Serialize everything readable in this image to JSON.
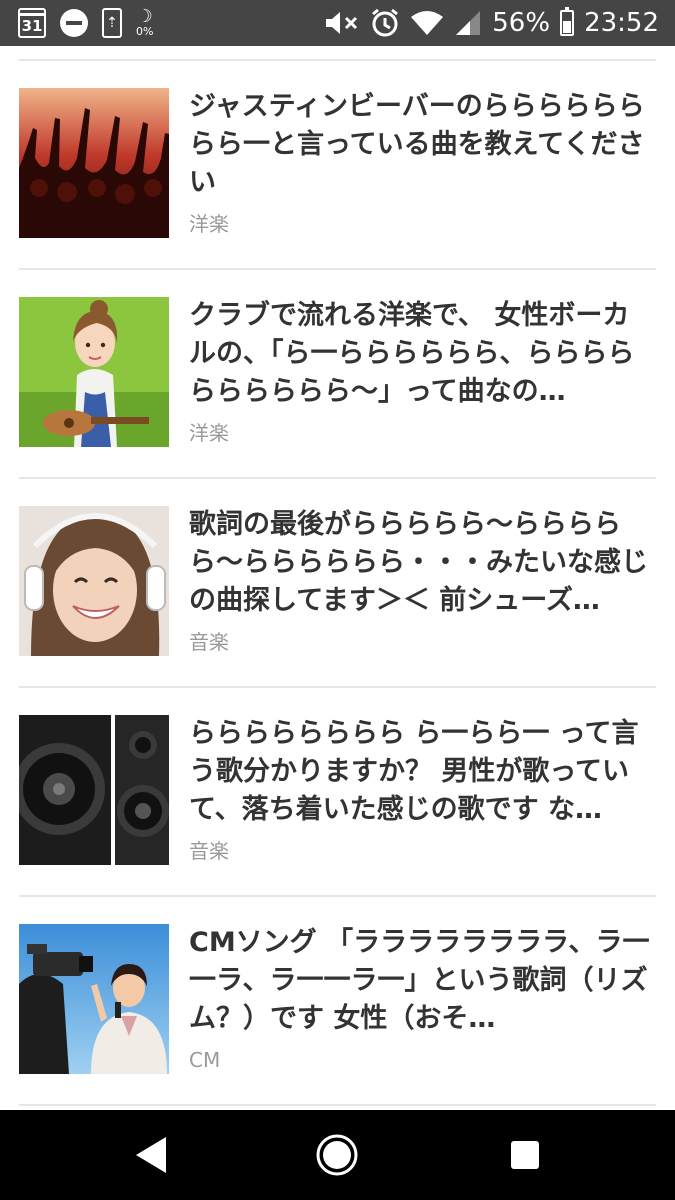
{
  "status_bar": {
    "calendar_day": "31",
    "battery_saver_percent": "0%",
    "battery_percent": "56%",
    "battery_level": 0.56,
    "time": "23:52",
    "icons": [
      "calendar-icon",
      "do-not-disturb-icon",
      "update-icon",
      "battery-saver-icon",
      "mute-icon",
      "alarm-icon",
      "wifi-icon",
      "cell-signal-icon",
      "battery-icon"
    ]
  },
  "items": [
    {
      "title": "ジャスティンビーバーのらららららららら一と言っている曲を教えてください",
      "category": "洋楽",
      "thumbnail": "concert-crowd"
    },
    {
      "title": "クラブで流れる洋楽で、 女性ボーカルの、「ら一らららららら、らららららららららら〜」って曲なの…",
      "category": "洋楽",
      "thumbnail": "woman-with-ukulele"
    },
    {
      "title": "歌詞の最後がららららら〜ららららら〜らららららら・・・みたいな感じの曲探してます＞＜ 前シューズ…",
      "category": "音楽",
      "thumbnail": "woman-with-headphones"
    },
    {
      "title": "らららららららら ら一らら一 って言う歌分かりますか？ 男性が歌っていて、落ち着いた感じの歌です な…",
      "category": "音楽",
      "thumbnail": "speakers"
    },
    {
      "title": "CMソング 「ララララララララ、ラ一一ラ、ラ一一ラ一」という歌詞（リズム？）です 女性（おそ…",
      "category": "CM",
      "thumbnail": "camera-and-speaker"
    }
  ],
  "nav_bar": {
    "back": "back-icon",
    "home": "home-icon",
    "recents": "recents-icon"
  }
}
